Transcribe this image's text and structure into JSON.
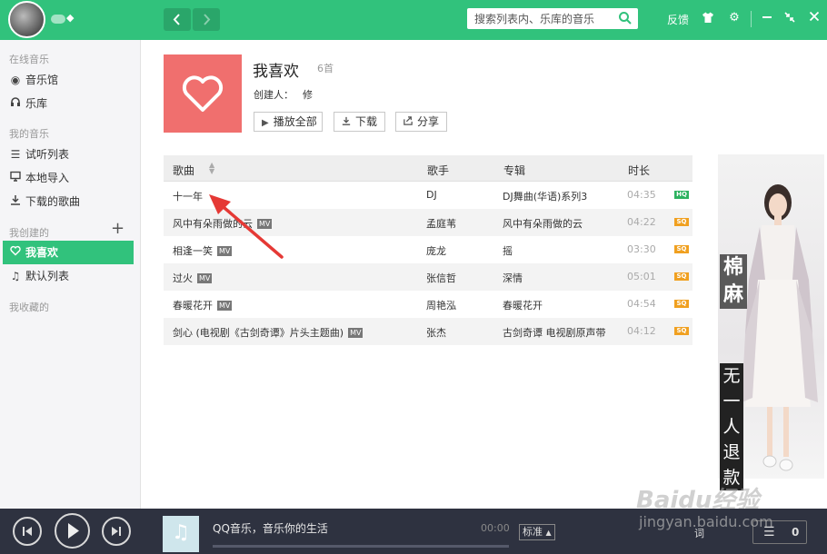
{
  "topbar": {
    "search_placeholder": "搜索列表内、乐库的音乐",
    "feedback": "反馈"
  },
  "sidebar": {
    "section_online": "在线音乐",
    "music_hall": "音乐馆",
    "library": "乐库",
    "section_my": "我的音乐",
    "trial_list": "试听列表",
    "local_import": "本地导入",
    "downloaded": "下载的歌曲",
    "section_created": "我创建的",
    "favorites": "我喜欢",
    "default_list": "默认列表",
    "section_collected": "我收藏的"
  },
  "playlist": {
    "title": "我喜欢",
    "count": "6首",
    "creator_label": "创建人：",
    "creator": "修",
    "play_all": "播放全部",
    "download": "下载",
    "share": "分享"
  },
  "table": {
    "headers": {
      "song": "歌曲",
      "artist": "歌手",
      "album": "专辑",
      "duration": "时长"
    },
    "rows": [
      {
        "song": "十一年",
        "mv": "",
        "artist": "DJ",
        "album": "DJ舞曲(华语)系列3",
        "duration": "04:35",
        "quality": "HQ"
      },
      {
        "song": "风中有朵雨做的云",
        "mv": "MV",
        "artist": "孟庭苇",
        "album": "风中有朵雨做的云",
        "duration": "04:22",
        "quality": "SQ"
      },
      {
        "song": "相逢一笑",
        "mv": "MV",
        "artist": "庞龙",
        "album": "摇",
        "duration": "03:30",
        "quality": "SQ"
      },
      {
        "song": "过火",
        "mv": "MV",
        "artist": "张信哲",
        "album": "深情",
        "duration": "05:01",
        "quality": "SQ"
      },
      {
        "song": "春暖花开",
        "mv": "MV",
        "artist": "周艳泓",
        "album": "春暖花开",
        "duration": "04:54",
        "quality": "SQ"
      },
      {
        "song": "剑心 (电视剧《古剑奇谭》片头主题曲)",
        "mv": "MV",
        "artist": "张杰",
        "album": "古剑奇谭 电视剧原声带",
        "duration": "04:12",
        "quality": "SQ"
      }
    ]
  },
  "ad": {
    "word_top": "棉麻",
    "word_bottom": "无一人退款"
  },
  "watermark": {
    "brand": "Baidu经验",
    "url": "jingyan.baidu.com"
  },
  "player": {
    "title": "QQ音乐，音乐你的生活",
    "time": "00:00",
    "progress": 0,
    "quality": "标准",
    "lyric": "词",
    "queue_count": "0"
  },
  "colors": {
    "brand_green": "#31c27c",
    "cover_red": "#f06f6e",
    "hq_badge": "#2db260",
    "sq_badge": "#f0a020",
    "player_bg": "#2e3240"
  },
  "icons": {
    "nav_back": "chevron-left-icon",
    "nav_forward": "chevron-right-icon",
    "search": "search-icon",
    "skin": "tshirt-icon",
    "settings": "gear-icon",
    "minimize": "minimize-icon",
    "mini_mode": "shrink-icon",
    "close": "close-icon"
  }
}
